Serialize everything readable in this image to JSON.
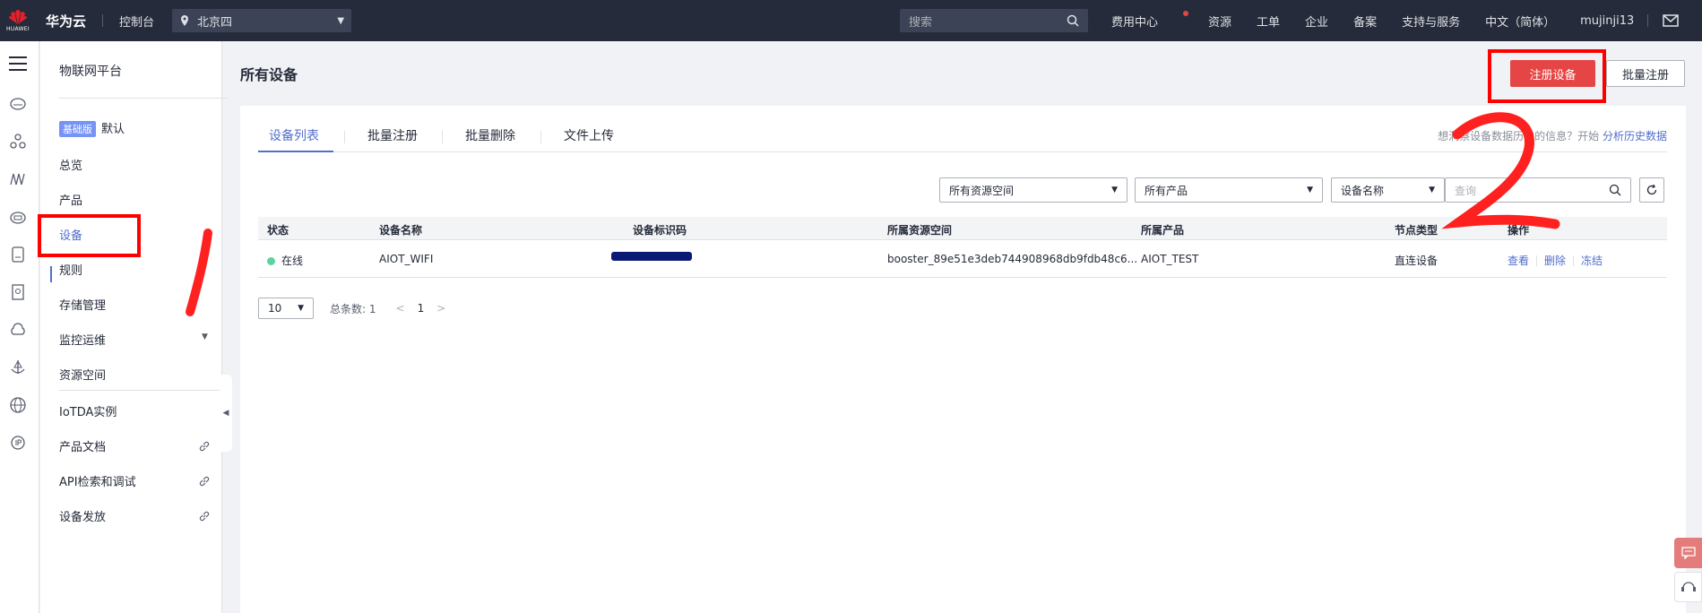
{
  "topbar": {
    "logo_text": "HUAWEI",
    "brand": "华为云",
    "console": "控制台",
    "region": "北京四",
    "search_placeholder": "搜索",
    "links": [
      "费用中心",
      "资源",
      "工单",
      "企业",
      "备案",
      "支持与服务",
      "中文（简体）"
    ],
    "username": "mujinji13"
  },
  "sidenav": {
    "title": "物联网平台",
    "badge": "基础版",
    "badge_suffix": "默认",
    "items": [
      "总览",
      "产品",
      "设备",
      "规则",
      "存储管理",
      "监控运维",
      "资源空间",
      "IoTDA实例",
      "产品文档",
      "API检索和调试",
      "设备发放"
    ],
    "active": "设备"
  },
  "page": {
    "title": "所有设备",
    "register_button": "注册设备",
    "batch_register_button": "批量注册"
  },
  "tabs": [
    "设备列表",
    "批量注册",
    "批量删除",
    "文件上传"
  ],
  "tip": {
    "text": "想洞察设备数据历次的信息？开始 ",
    "link": "分析历史数据"
  },
  "filters": {
    "resource_space": "所有资源空间",
    "product": "所有产品",
    "field": "设备名称",
    "query_placeholder": "查询"
  },
  "table": {
    "columns": [
      "状态",
      "设备名称",
      "设备标识码",
      "所属资源空间",
      "所属产品",
      "节点类型",
      "操作"
    ],
    "rows": [
      {
        "status": "在线",
        "name": "AIOT_WIFI",
        "device_id": "",
        "resource_space": "booster_89e51e3deb744908968db9fdb48c6...",
        "product": "AIOT_TEST",
        "node_type": "直连设备",
        "actions": [
          "查看",
          "删除",
          "冻结"
        ]
      }
    ]
  },
  "pager": {
    "page_size": "10",
    "total": "总条数: 1",
    "current_page": "1"
  },
  "annotations": {
    "label_1": "1",
    "label_2": "2"
  },
  "colors": {
    "topbar": "#252b3a",
    "primary": "#e54545",
    "link": "#526ecc",
    "annotation": "#ff0000"
  }
}
